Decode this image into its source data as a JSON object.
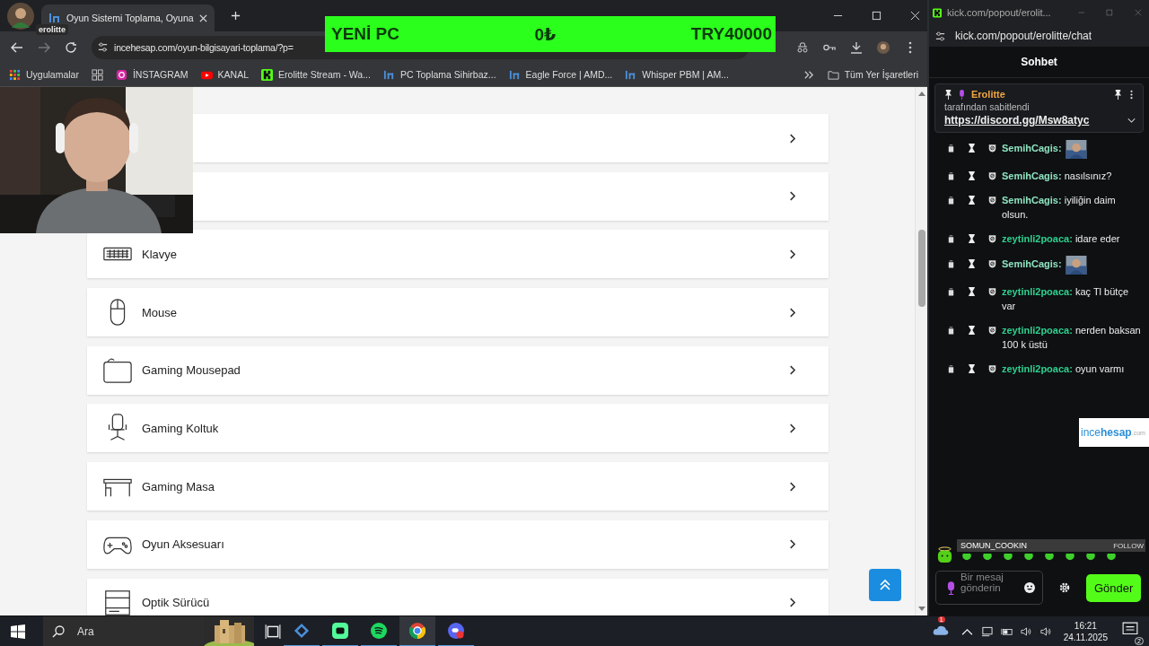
{
  "browser": {
    "profile_tooltip": "erolitte",
    "tab_title": "Oyun Sistemi Toplama, Oyuna",
    "url": "incehesap.com/oyun-bilgisayari-toplama/?p=",
    "bookmarks": [
      {
        "label": "Uygulamalar",
        "kind": "apps"
      },
      {
        "label": "İNSTAGRAM",
        "kind": "instagram"
      },
      {
        "label": "KANAL",
        "kind": "video"
      },
      {
        "label": "Erolitte Stream - Wa...",
        "kind": "kick"
      },
      {
        "label": "PC Toplama Sihirbaz...",
        "kind": "site"
      },
      {
        "label": "Eagle Force | AMD...",
        "kind": "site"
      },
      {
        "label": "Whisper PBM | AM...",
        "kind": "site"
      }
    ],
    "all_bookmarks": "Tüm Yer İşaretleri"
  },
  "budget_overlay": {
    "title": "YENİ PC",
    "spent": "0₺",
    "budget": "TRY40000"
  },
  "categories": [
    {
      "kind": "blank"
    },
    {
      "kind": "blank"
    },
    {
      "label": "Klavye",
      "kind": "keyboard"
    },
    {
      "label": "Mouse",
      "kind": "mouse"
    },
    {
      "label": "Gaming Mousepad",
      "kind": "mousepad"
    },
    {
      "label": "Gaming Koltuk",
      "kind": "chair"
    },
    {
      "label": "Gaming Masa",
      "kind": "desk"
    },
    {
      "label": "Oyun Aksesuarı",
      "kind": "gamepad"
    },
    {
      "label": "Optik Sürücü",
      "kind": "drive"
    }
  ],
  "chat": {
    "window_title": "kick.com/popout/erolit...",
    "url": "kick.com/popout/erolitte/chat",
    "heading": "Sohbet",
    "pinned": {
      "author": "Erolitte",
      "note": "tarafından sabitlendi",
      "link": "https://discord.gg/Msw8atyc"
    },
    "messages": [
      {
        "user": "SemihCagis:",
        "color": "#8fe3c0",
        "kind": "emote"
      },
      {
        "user": "SemihCagis:",
        "color": "#8fe3c0",
        "kind": "text",
        "text": "nasılsınız?"
      },
      {
        "user": "SemihCagis:",
        "color": "#8fe3c0",
        "kind": "text",
        "text": "iyiliğin daim olsun."
      },
      {
        "user": "zeytinli2poaca:",
        "color": "#2fd08f",
        "kind": "text",
        "text": "idare eder"
      },
      {
        "user": "SemihCagis:",
        "color": "#8fe3c0",
        "kind": "emote"
      },
      {
        "user": "zeytinli2poaca:",
        "color": "#2fd08f",
        "kind": "text",
        "text": "kaç Tl bütçe var"
      },
      {
        "user": "zeytinli2poaca:",
        "color": "#2fd08f",
        "kind": "text",
        "text": "nerden baksan 100 k üstü"
      },
      {
        "user": "zeytinli2poaca:",
        "color": "#2fd08f",
        "kind": "text",
        "text": "oyun varmı"
      }
    ],
    "logo": {
      "part1": "ince",
      "part2": "hesap",
      "part3": ".com"
    },
    "follow_banner": {
      "name": "SOMUN_COOKIN",
      "action": "FOLLOW"
    },
    "input": {
      "placeholder": "Bir mesaj gönderin"
    },
    "send": "Gönder"
  },
  "taskbar": {
    "search_placeholder": "Ara",
    "weather_badge": "1",
    "time": "16:21",
    "date": "24.11.2025",
    "notifications": "2"
  }
}
